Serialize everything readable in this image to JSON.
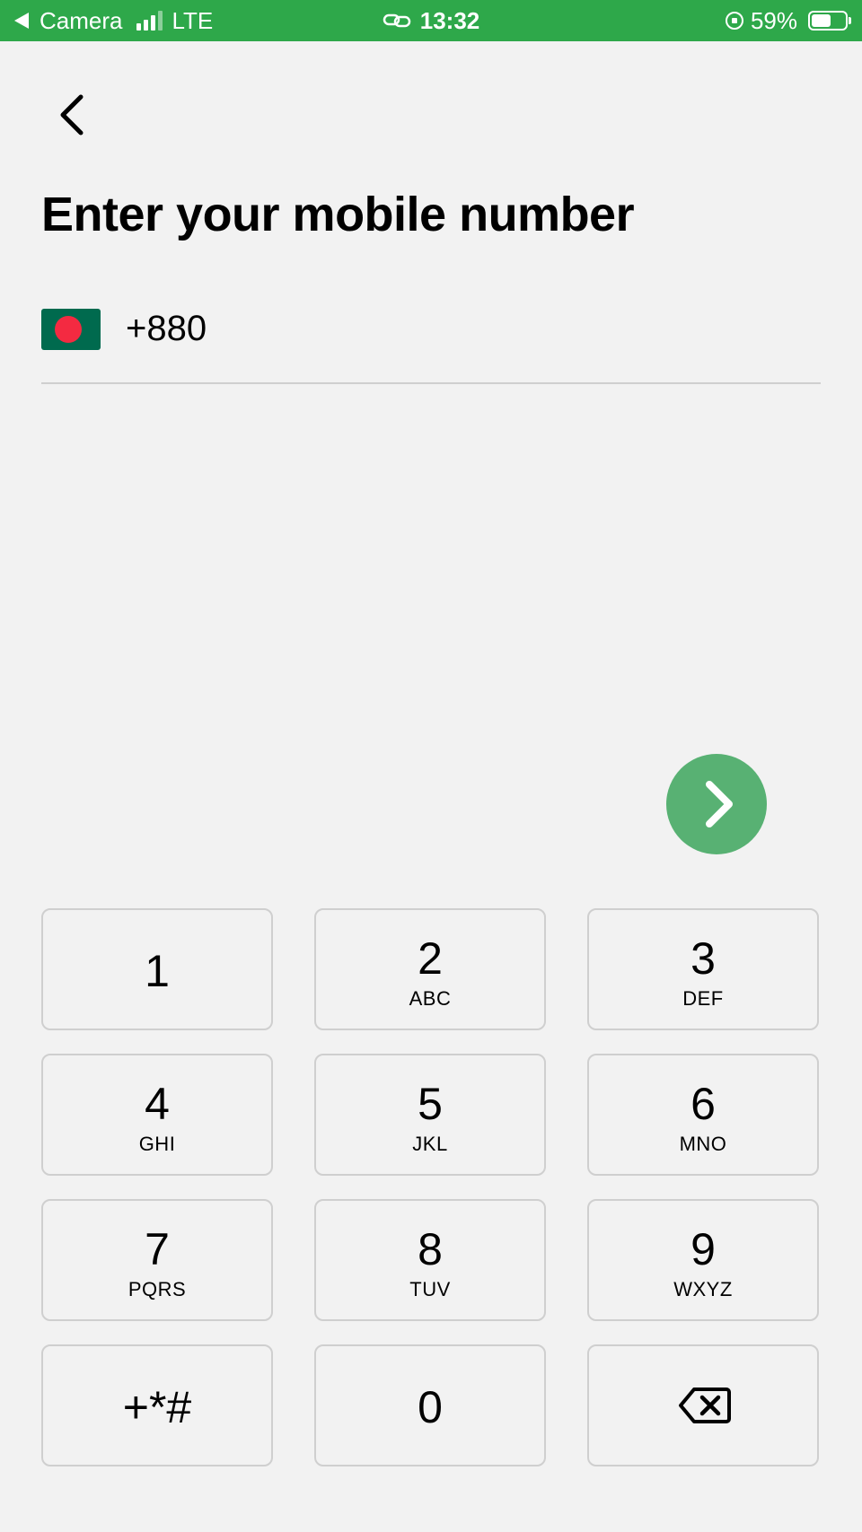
{
  "status_bar": {
    "back_app": "Camera",
    "network": "LTE",
    "time": "13:32",
    "battery": "59%",
    "battery_level": 0.59,
    "signal_bars": 3
  },
  "page": {
    "title": "Enter your mobile number"
  },
  "phone": {
    "country": "Bangladesh",
    "country_code": "+880",
    "value": ""
  },
  "colors": {
    "status_bar": "#2ea84a",
    "next_button": "#58b173",
    "background": "#f2f2f2"
  },
  "keypad": {
    "keys": [
      {
        "digit": "1",
        "letters": ""
      },
      {
        "digit": "2",
        "letters": "ABC"
      },
      {
        "digit": "3",
        "letters": "DEF"
      },
      {
        "digit": "4",
        "letters": "GHI"
      },
      {
        "digit": "5",
        "letters": "JKL"
      },
      {
        "digit": "6",
        "letters": "MNO"
      },
      {
        "digit": "7",
        "letters": "PQRS"
      },
      {
        "digit": "8",
        "letters": "TUV"
      },
      {
        "digit": "9",
        "letters": "WXYZ"
      },
      {
        "digit": "+*#",
        "letters": ""
      },
      {
        "digit": "0",
        "letters": ""
      },
      {
        "digit": "",
        "letters": "",
        "icon": "backspace-icon"
      }
    ]
  }
}
